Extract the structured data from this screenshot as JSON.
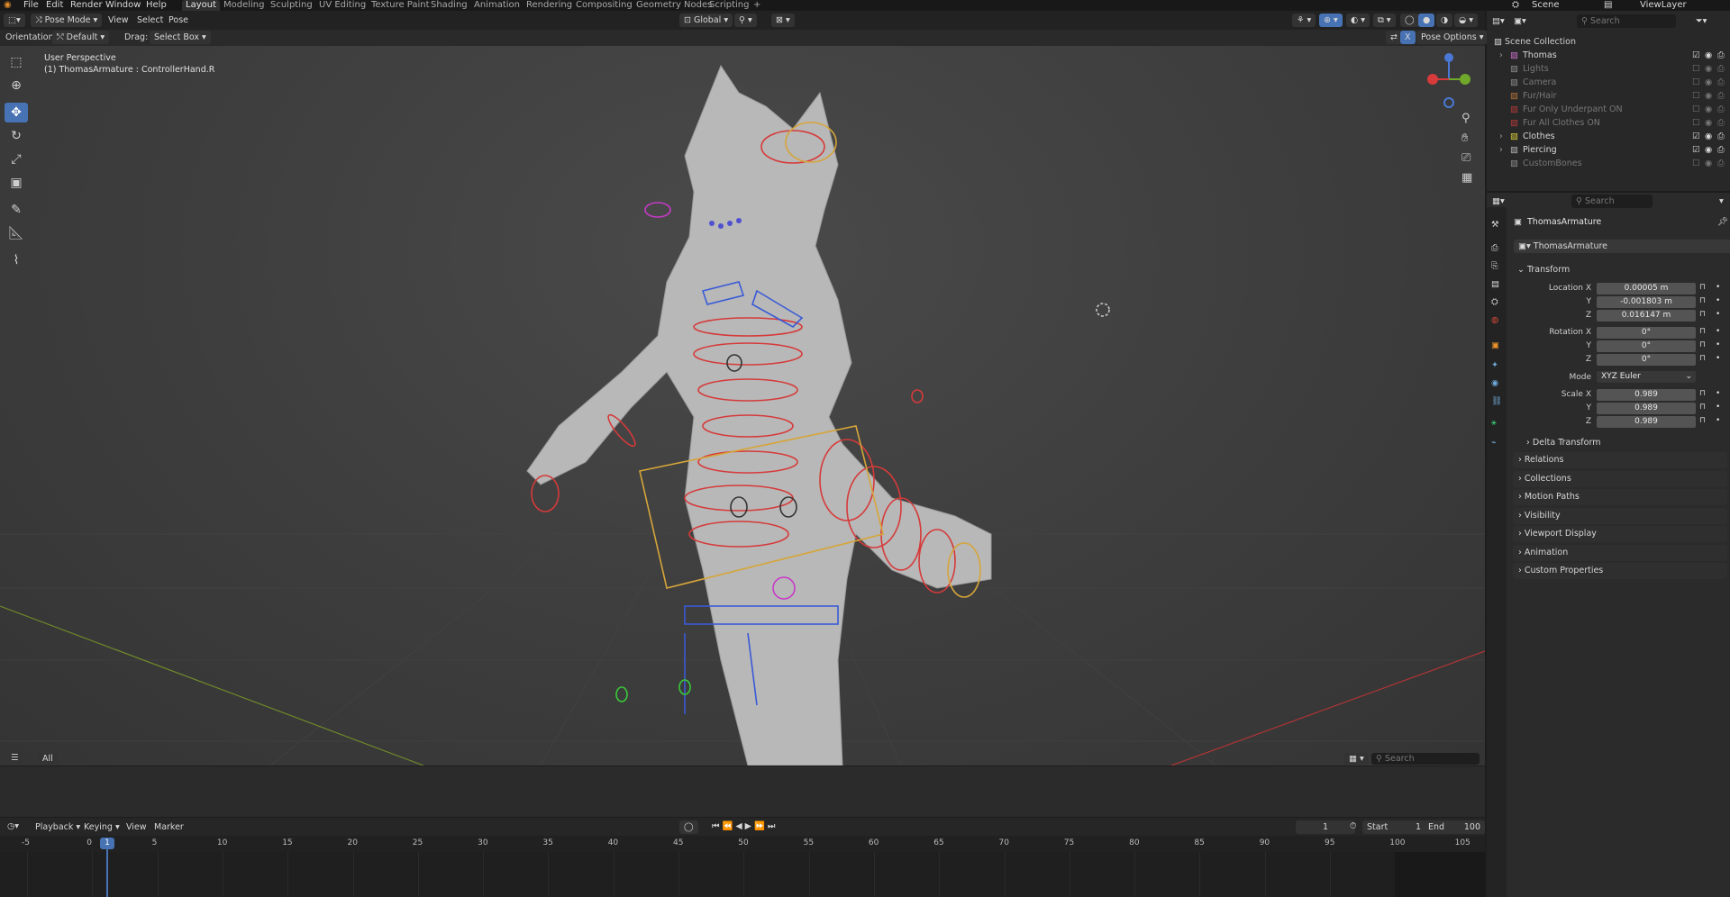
{
  "menus": [
    "File",
    "Edit",
    "Render",
    "Window",
    "Help"
  ],
  "workspaces": [
    "Layout",
    "Modeling",
    "Sculpting",
    "UV Editing",
    "Texture Paint",
    "Shading",
    "Animation",
    "Rendering",
    "Compositing",
    "Geometry Nodes",
    "Scripting"
  ],
  "scene": {
    "name": "Scene",
    "view_layer": "ViewLayer",
    "search_placeholder": "Search"
  },
  "viewport_header": {
    "mode": "Pose Mode",
    "menus": [
      "View",
      "Select",
      "Pose"
    ],
    "transform_orientation": "Global",
    "orientation_label": "Orientation:",
    "orientation_value": "Default",
    "drag_label": "Drag:",
    "drag_value": "Select Box",
    "pose_options": "Pose Options"
  },
  "viewport_info": {
    "perspective": "User Perspective",
    "object": "(1) ThomasArmature : ControllerHand.R"
  },
  "viewport_footer": {
    "tab": "All",
    "search_placeholder": "Search"
  },
  "timeline": {
    "menus": [
      "Playback",
      "Keying",
      "View",
      "Marker"
    ],
    "current_frame": "1",
    "start_label": "Start",
    "start": "1",
    "end_label": "End",
    "end": "100",
    "ticks": [
      "-5",
      "0",
      "5",
      "10",
      "15",
      "20",
      "25",
      "30",
      "35",
      "40",
      "45",
      "50",
      "55",
      "60",
      "65",
      "70",
      "75",
      "80",
      "85",
      "90",
      "95",
      "100",
      "105"
    ],
    "playhead": "1"
  },
  "outliner": {
    "root": "Scene Collection",
    "items": [
      {
        "name": "Thomas",
        "active": true
      },
      {
        "name": "Lights",
        "active": false
      },
      {
        "name": "Camera",
        "active": false
      },
      {
        "name": "Fur/Hair",
        "active": false
      },
      {
        "name": "Fur Only Underpant ON",
        "active": false
      },
      {
        "name": "Fur All Clothes ON",
        "active": false
      },
      {
        "name": "Clothes",
        "active": true
      },
      {
        "name": "Piercing",
        "active": true
      },
      {
        "name": "CustomBones",
        "active": false
      }
    ]
  },
  "properties": {
    "search_placeholder": "Search",
    "object_name": "ThomasArmature",
    "data_name": "ThomasArmature",
    "transform": {
      "title": "Transform",
      "location_label": "Location X",
      "location": [
        "0.00005 m",
        "-0.001803 m",
        "0.016147 m"
      ],
      "rotation_label": "Rotation X",
      "rotation": [
        "0°",
        "0°",
        "0°"
      ],
      "mode_label": "Mode",
      "mode": "XYZ Euler",
      "scale_label": "Scale X",
      "scale": [
        "0.989",
        "0.989",
        "0.989"
      ],
      "axis_labels": [
        "Y",
        "Z"
      ]
    },
    "delta": "Delta Transform",
    "panels": [
      "Relations",
      "Collections",
      "Motion Paths",
      "Visibility",
      "Viewport Display",
      "Animation",
      "Custom Properties"
    ]
  },
  "colors": {
    "accent": "#4772b3",
    "bone_red": "#d63a3a",
    "bone_yellow": "#d6a53a",
    "bone_blue": "#3a5ad6",
    "bone_magenta": "#c83ac8",
    "bone_green": "#3ac83a"
  }
}
